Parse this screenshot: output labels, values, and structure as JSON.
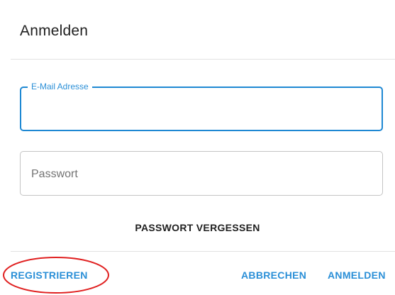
{
  "dialog": {
    "title": "Anmelden"
  },
  "form": {
    "email": {
      "label": "E-Mail Adresse",
      "value": ""
    },
    "password": {
      "placeholder": "Passwort",
      "value": ""
    },
    "forgot_label": "PASSWORT VERGESSEN"
  },
  "actions": {
    "register_label": "REGISTRIEREN",
    "cancel_label": "ABBRECHEN",
    "login_label": "ANMELDEN"
  },
  "colors": {
    "accent": "#1e88d3",
    "annotation": "#e02020"
  }
}
